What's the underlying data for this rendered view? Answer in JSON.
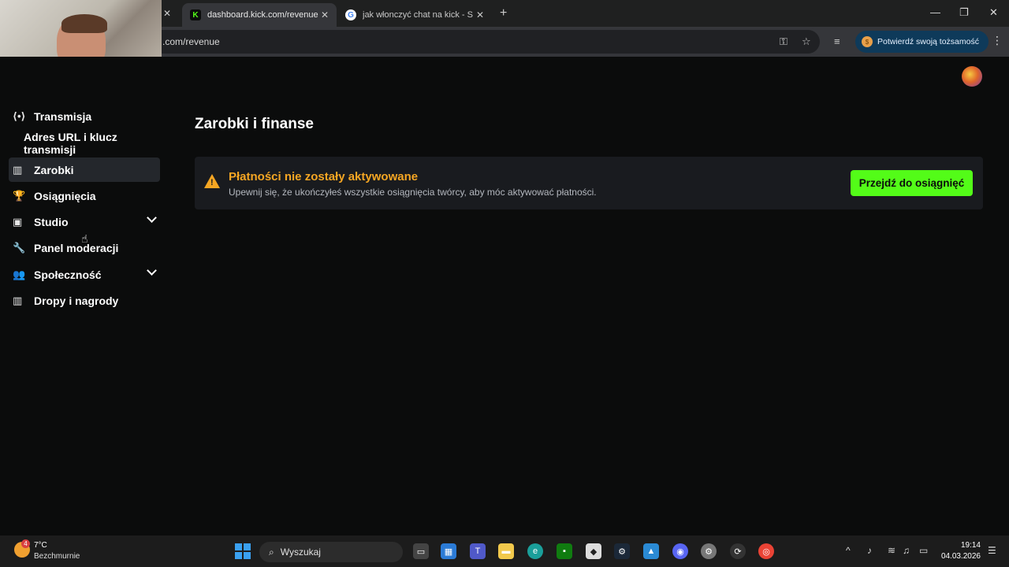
{
  "browser": {
    "tabs": [
      {
        "title": "dashboard.kick.com/revenue",
        "favicon": "K",
        "active": true
      },
      {
        "title": "jak włonczyć chat na kick - Szuk",
        "favicon": "G",
        "active": false
      }
    ],
    "url": ".com/revenue",
    "identity_button": "Potwierdź swoją tożsamość"
  },
  "sidebar": {
    "items": [
      {
        "label": "Transmisja",
        "icon": "broadcast-icon"
      },
      {
        "label": "Adres URL i klucz transmisji",
        "icon": ""
      },
      {
        "label": "Zarobki",
        "icon": "chart-icon",
        "active": true
      },
      {
        "label": "Osiągnięcia",
        "icon": "trophy-icon"
      },
      {
        "label": "Studio",
        "icon": "studio-icon",
        "expandable": true
      },
      {
        "label": "Panel moderacji",
        "icon": "wrench-icon"
      },
      {
        "label": "Społeczność",
        "icon": "people-icon",
        "expandable": true
      },
      {
        "label": "Dropy i nagrody",
        "icon": "gift-icon"
      }
    ]
  },
  "main": {
    "title": "Zarobki i finanse",
    "alert": {
      "title": "Płatności nie zostały aktywowane",
      "description": "Upewnij się, że ukończyłeś wszystkie osiągnięcia twórcy, aby móc aktywować płatności.",
      "button": "Przejdź do osiągnięć"
    }
  },
  "taskbar": {
    "weather": {
      "temp": "7°C",
      "desc": "Bezchmurnie",
      "badge": "4"
    },
    "search_placeholder": "Wyszukaj",
    "time": "19:14",
    "date": "04.03.2026"
  },
  "colors": {
    "accent": "#53fc18",
    "warning": "#f5a623",
    "background": "#0b0c0c"
  }
}
